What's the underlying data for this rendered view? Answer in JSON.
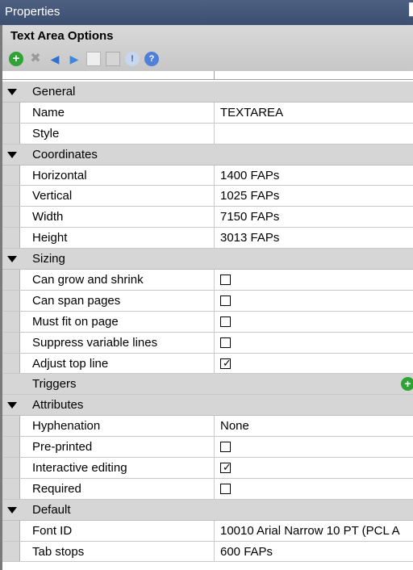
{
  "window": {
    "title": "Properties",
    "pin_glyph": "▐"
  },
  "panel": {
    "title": "Text Area Options"
  },
  "toolbar": {
    "buttons": [
      {
        "name": "add-icon",
        "glyph": "+"
      },
      {
        "name": "delete-icon",
        "glyph": "✖"
      },
      {
        "name": "previous-icon",
        "glyph": "◀"
      },
      {
        "name": "next-icon",
        "glyph": "▶"
      },
      {
        "name": "copy-icon",
        "glyph": ""
      },
      {
        "name": "paste-icon",
        "glyph": ""
      },
      {
        "name": "info-icon",
        "glyph": "!"
      },
      {
        "name": "help-icon",
        "glyph": "?"
      }
    ]
  },
  "grid": {
    "general": {
      "label": "General",
      "name": {
        "label": "Name",
        "value": "TEXTAREA"
      },
      "style": {
        "label": "Style",
        "value": ""
      }
    },
    "coordinates": {
      "label": "Coordinates",
      "horizontal": {
        "label": "Horizontal",
        "value": "1400 FAPs"
      },
      "vertical": {
        "label": "Vertical",
        "value": "1025 FAPs"
      },
      "width": {
        "label": "Width",
        "value": "7150 FAPs"
      },
      "height": {
        "label": "Height",
        "value": "3013 FAPs"
      }
    },
    "sizing": {
      "label": "Sizing",
      "can_grow": {
        "label": "Can grow and shrink",
        "checked": false
      },
      "can_span": {
        "label": "Can span pages",
        "checked": false
      },
      "must_fit": {
        "label": "Must fit on page",
        "checked": false
      },
      "suppress": {
        "label": "Suppress variable lines",
        "checked": false
      },
      "adjust_top": {
        "label": "Adjust top line",
        "checked": true
      }
    },
    "triggers": {
      "label": "Triggers"
    },
    "attributes": {
      "label": "Attributes",
      "hyphenation": {
        "label": "Hyphenation",
        "value": "None"
      },
      "preprinted": {
        "label": "Pre-printed",
        "checked": false
      },
      "interactive": {
        "label": "Interactive editing",
        "checked": true
      },
      "required": {
        "label": "Required",
        "checked": false
      }
    },
    "default": {
      "label": "Default",
      "font_id": {
        "label": "Font ID",
        "value": "10010 Arial Narrow 10 PT (PCL A"
      },
      "tab_stops": {
        "label": "Tab stops",
        "value": "600 FAPs"
      }
    }
  },
  "check_glyph": "✓"
}
